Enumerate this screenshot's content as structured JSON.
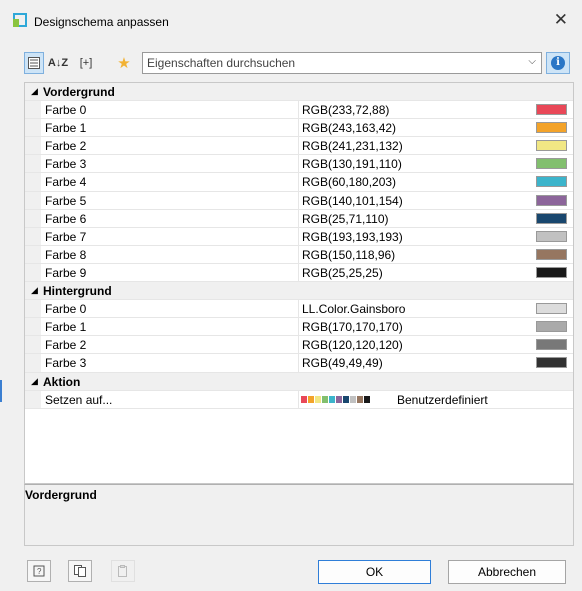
{
  "window": {
    "title": "Designschema anpassen",
    "close_glyph": "✕"
  },
  "toolbar": {
    "categorized_icon": "categorized-icon",
    "sort_label": "A↓Z",
    "expand_label": "[+]",
    "star_glyph": "★",
    "search_placeholder": "Eigenschaften durchsuchen",
    "dropdown_glyph": "⌵",
    "info_glyph": "i"
  },
  "groups": [
    {
      "name": "Vordergrund",
      "rows": [
        {
          "name": "Farbe 0",
          "value": "RGB(233,72,88)",
          "color": "#e94858"
        },
        {
          "name": "Farbe 1",
          "value": "RGB(243,163,42)",
          "color": "#f3a32a"
        },
        {
          "name": "Farbe 2",
          "value": "RGB(241,231,132)",
          "color": "#f1e784"
        },
        {
          "name": "Farbe 3",
          "value": "RGB(130,191,110)",
          "color": "#82bf6e"
        },
        {
          "name": "Farbe 4",
          "value": "RGB(60,180,203)",
          "color": "#3cb4cb"
        },
        {
          "name": "Farbe 5",
          "value": "RGB(140,101,154)",
          "color": "#8c659a"
        },
        {
          "name": "Farbe 6",
          "value": "RGB(25,71,110)",
          "color": "#19476e"
        },
        {
          "name": "Farbe 7",
          "value": "RGB(193,193,193)",
          "color": "#c1c1c1"
        },
        {
          "name": "Farbe 8",
          "value": "RGB(150,118,96)",
          "color": "#967660"
        },
        {
          "name": "Farbe 9",
          "value": "RGB(25,25,25)",
          "color": "#191919"
        }
      ]
    },
    {
      "name": "Hintergrund",
      "rows": [
        {
          "name": "Farbe 0",
          "value": "LL.Color.Gainsboro",
          "color": "#dcdcdc"
        },
        {
          "name": "Farbe 1",
          "value": "RGB(170,170,170)",
          "color": "#aaaaaa"
        },
        {
          "name": "Farbe 2",
          "value": "RGB(120,120,120)",
          "color": "#787878"
        },
        {
          "name": "Farbe 3",
          "value": "RGB(49,49,49)",
          "color": "#313131"
        }
      ]
    },
    {
      "name": "Aktion",
      "rows": [
        {
          "name": "Setzen auf...",
          "value": "Benutzerdefiniert",
          "palette": [
            "#e94858",
            "#f3a32a",
            "#f1e784",
            "#82bf6e",
            "#3cb4cb",
            "#8c659a",
            "#19476e",
            "#c1c1c1",
            "#967660",
            "#191919"
          ]
        }
      ]
    }
  ],
  "description": {
    "title": "Vordergrund"
  },
  "buttons": {
    "ok": "OK",
    "cancel": "Abbrechen"
  },
  "bottom_icons": [
    "help-icon",
    "copy-icon",
    "paste-icon"
  ]
}
